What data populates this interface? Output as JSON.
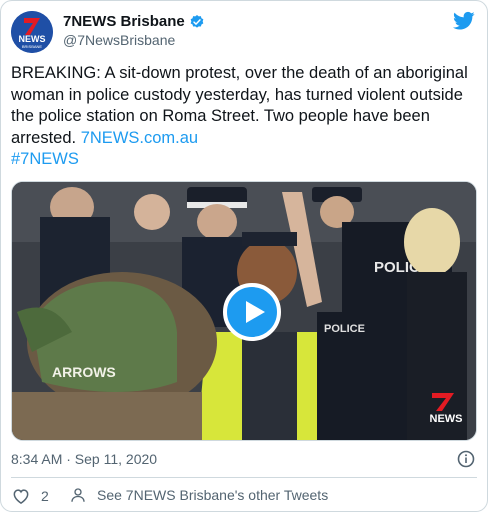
{
  "colors": {
    "accent": "#1d9bf0",
    "text": "#0f1419",
    "muted": "#536471",
    "brand": "#1f4fa6"
  },
  "author": {
    "display_name": "7NEWS Brisbane",
    "handle": "@7NewsBrisbane",
    "verified": true,
    "avatar_logo_number": "7",
    "avatar_logo_word": "NEWS",
    "avatar_logo_sub": "BRISBANE"
  },
  "tweet": {
    "text": "BREAKING: A sit-down protest, over the death of an aboriginal woman in police custody yesterday,  has turned violent outside the police station on Roma Street. Two people have been arrested.",
    "link": "7NEWS.com.au",
    "hashtag": "#7NEWS"
  },
  "media": {
    "type": "video",
    "play_icon": "play-icon",
    "watermark_number": "7",
    "watermark_word": "NEWS",
    "cap_text": "ARROWS",
    "vest_text": "POLICE",
    "shirt_text": "POLICE"
  },
  "meta": {
    "timestamp": "8:34 AM · Sep 11, 2020",
    "info_icon": "info-icon"
  },
  "actions": {
    "like_count": "2",
    "like_icon": "heart-icon",
    "profile_icon": "person-icon",
    "profile_label": "See 7NEWS Brisbane's other Tweets"
  },
  "platform_icon": "twitter-bird-icon"
}
